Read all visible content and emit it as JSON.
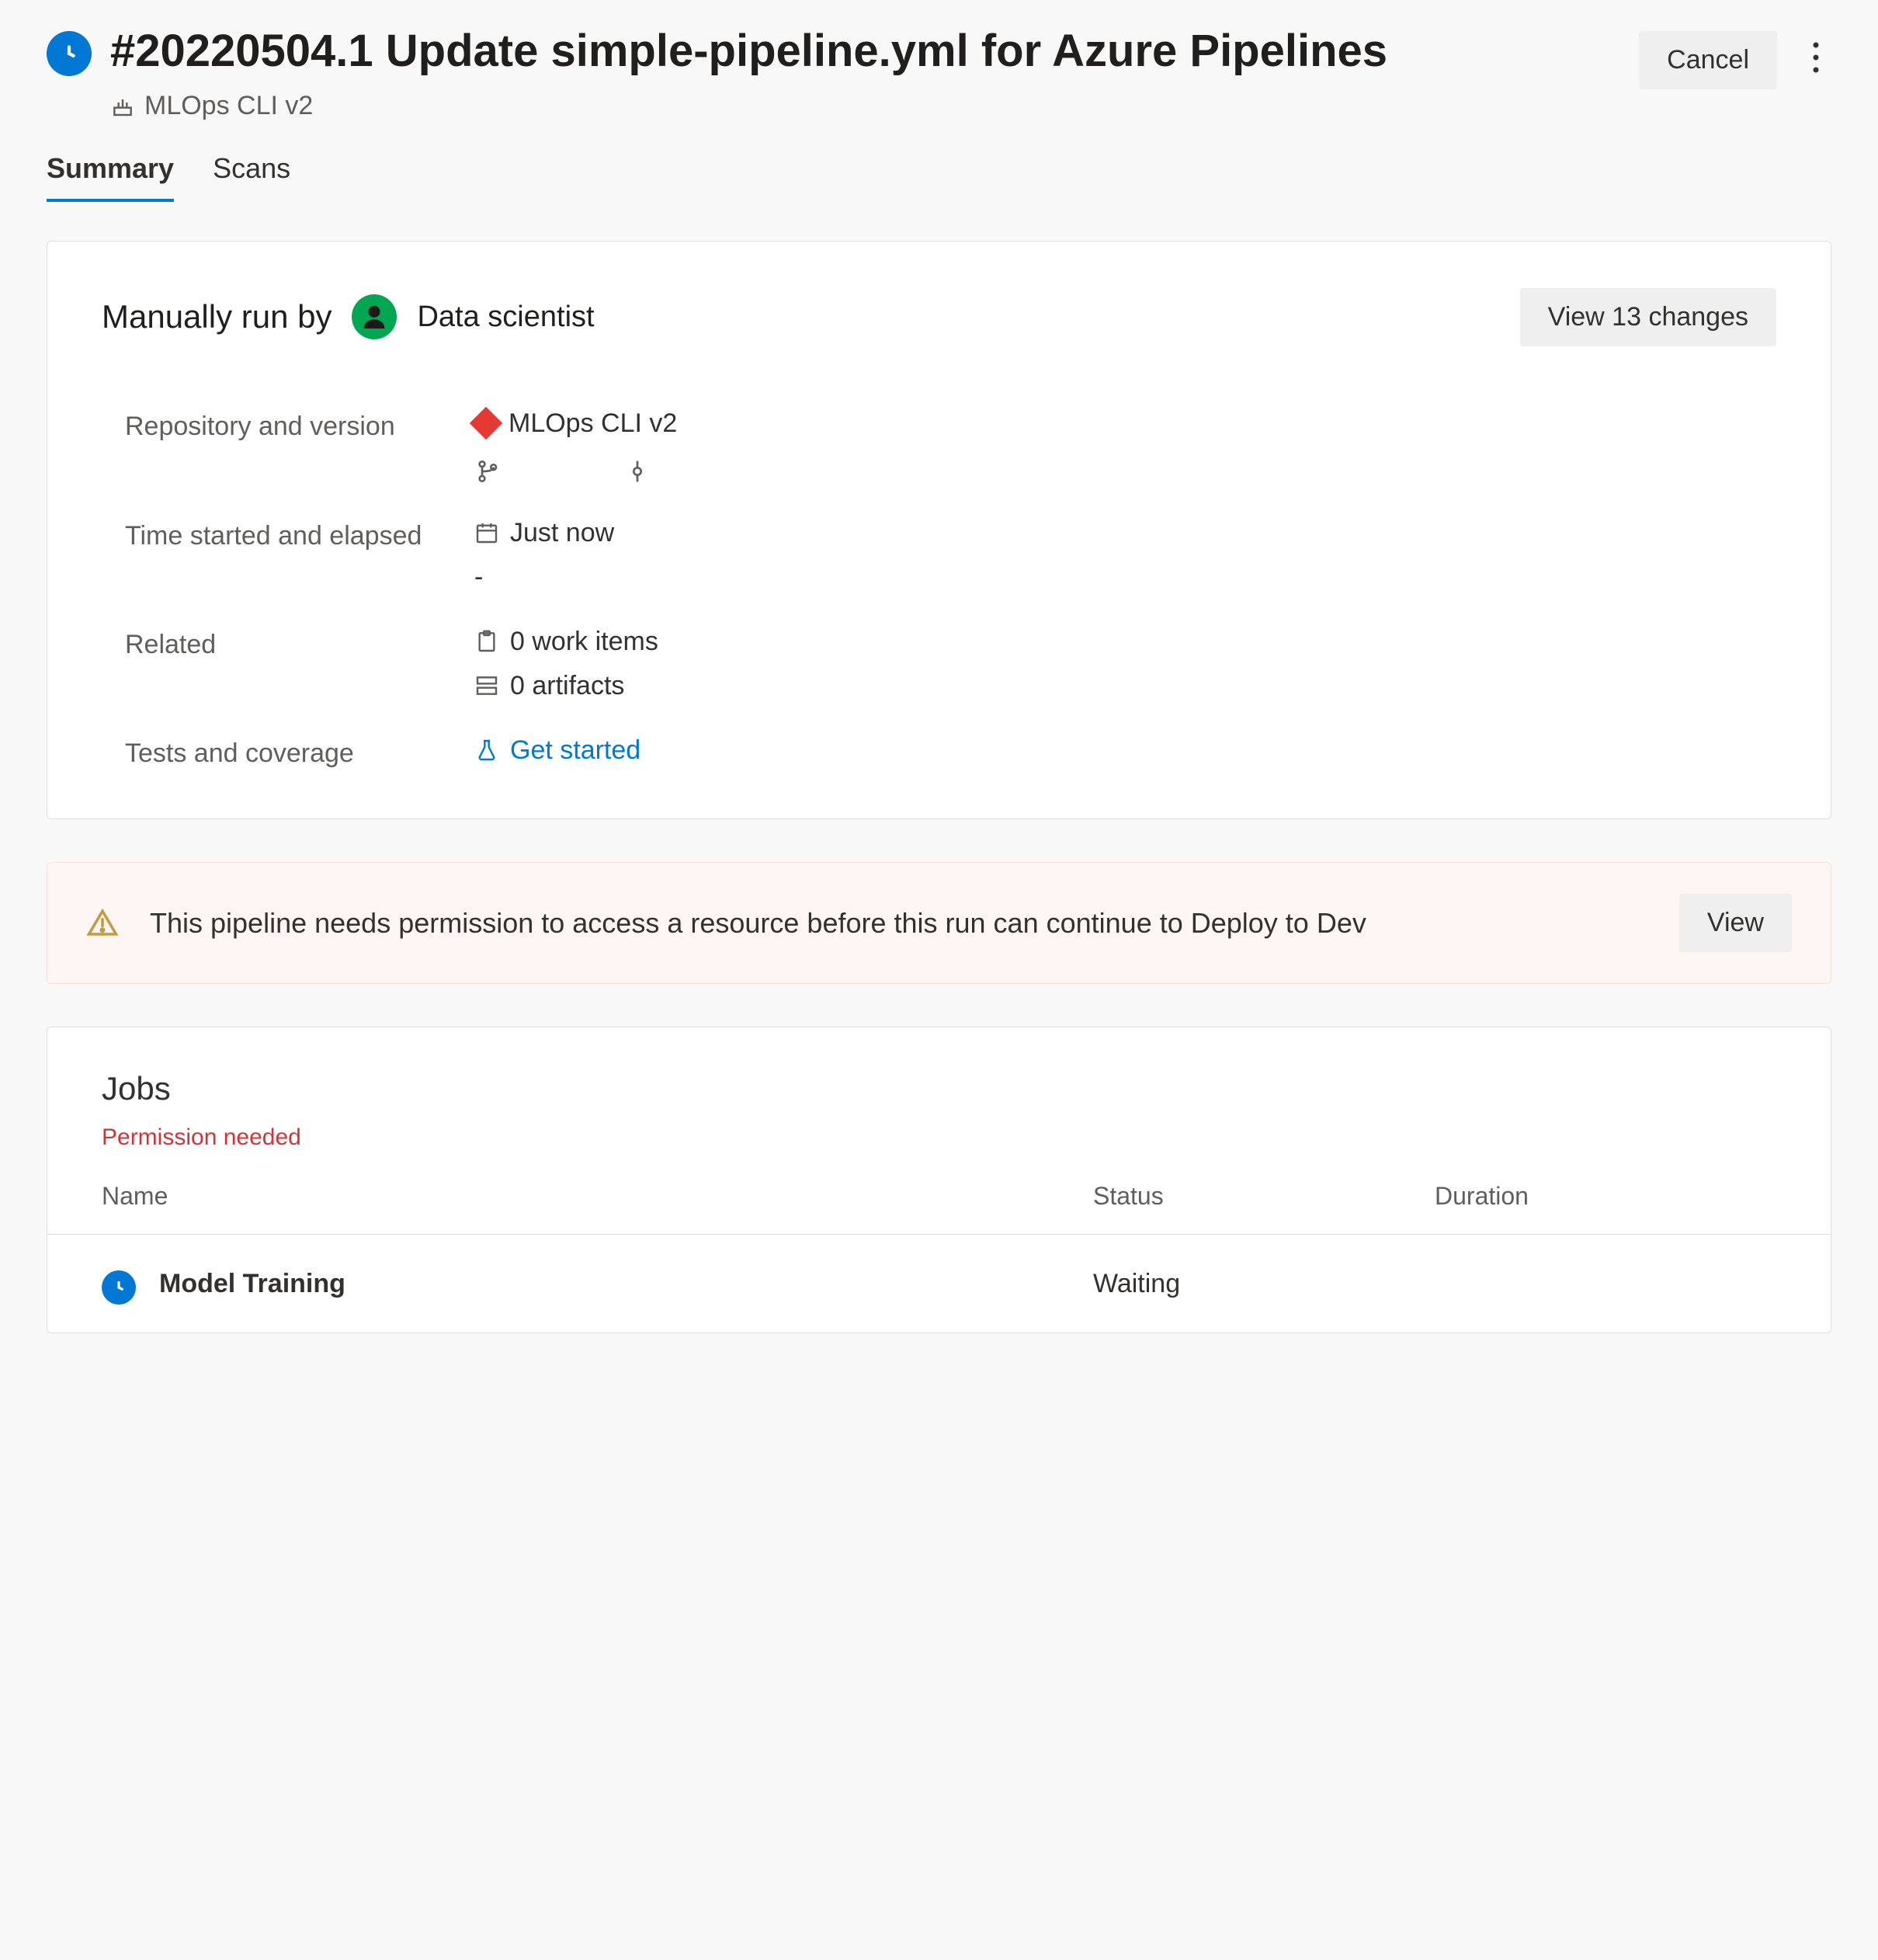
{
  "header": {
    "title": "#20220504.1 Update simple-pipeline.yml for Azure Pipelines",
    "pipeline_name": "MLOps CLI v2",
    "cancel_label": "Cancel"
  },
  "tabs": [
    {
      "label": "Summary",
      "active": true
    },
    {
      "label": "Scans",
      "active": false
    }
  ],
  "summary": {
    "run_by_label": "Manually run by",
    "run_by_name": "Data scientist",
    "view_changes_label": "View 13 changes",
    "rows": {
      "repo_label": "Repository and version",
      "repo_value": "MLOps CLI v2",
      "time_label": "Time started and elapsed",
      "time_value": "Just now",
      "elapsed_value": "-",
      "related_label": "Related",
      "work_items": "0 work items",
      "artifacts": "0 artifacts",
      "tests_label": "Tests and coverage",
      "tests_link": "Get started"
    }
  },
  "banner": {
    "text": "This pipeline needs permission to access a resource before this run can continue to Deploy to Dev",
    "view_label": "View"
  },
  "jobs": {
    "heading": "Jobs",
    "permission_text": "Permission needed",
    "columns": {
      "name": "Name",
      "status": "Status",
      "duration": "Duration"
    },
    "rows": [
      {
        "name": "Model Training",
        "status": "Waiting",
        "duration": ""
      }
    ]
  }
}
